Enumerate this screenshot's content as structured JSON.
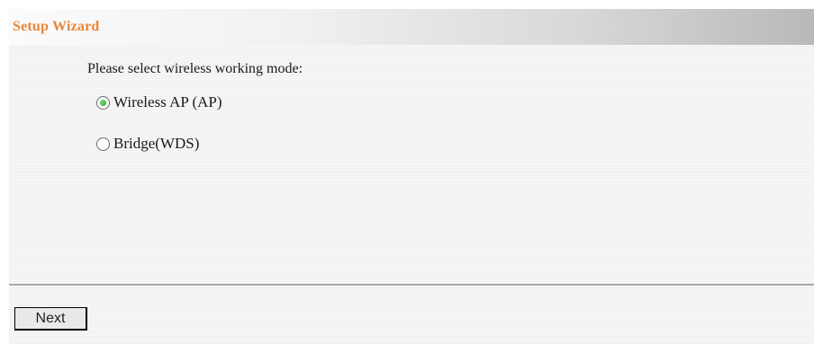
{
  "header": {
    "title": "Setup Wizard"
  },
  "main": {
    "prompt": "Please select wireless working mode:",
    "options": [
      {
        "label": "Wireless AP (AP)",
        "selected": true
      },
      {
        "label": "Bridge(WDS)",
        "selected": false
      }
    ]
  },
  "footer": {
    "next_label": "Next"
  },
  "colors": {
    "title": "#e8873a",
    "radio_selected": "#1f9a1f"
  }
}
